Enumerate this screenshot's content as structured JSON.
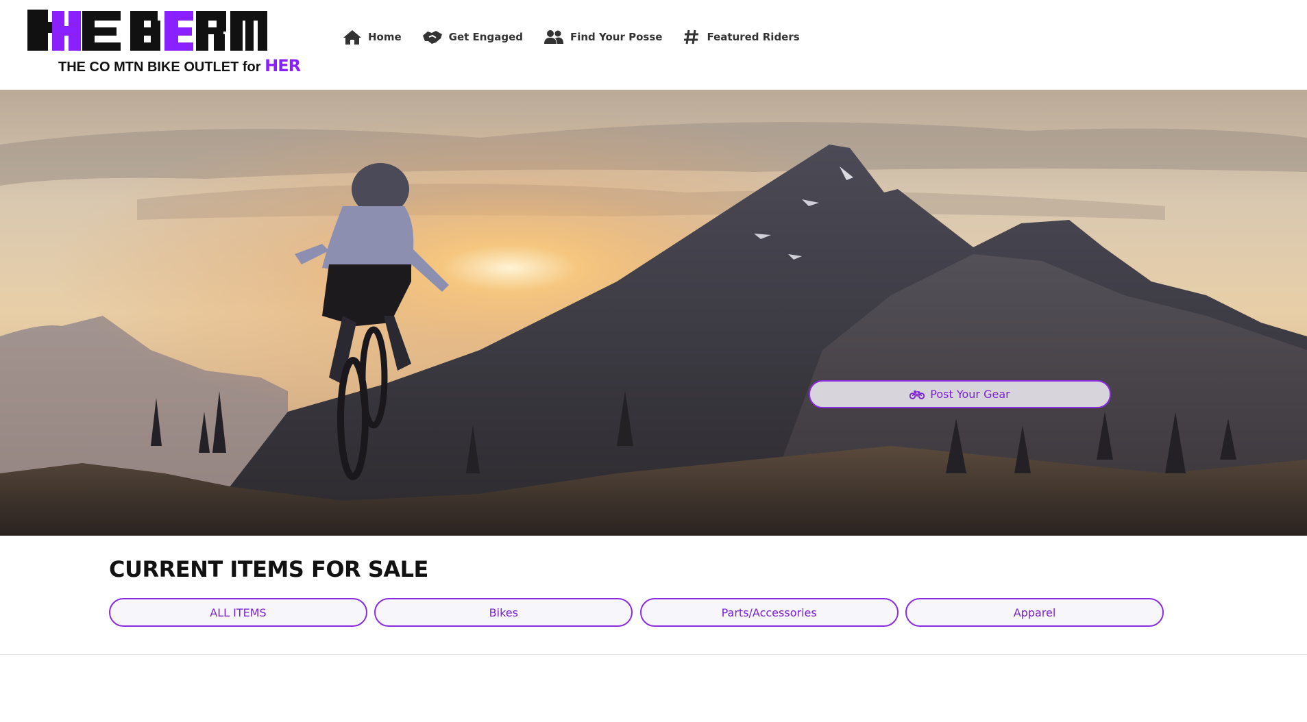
{
  "brand": {
    "logo_word": "tHE BERM",
    "tagline": "THE CO MTN BIKE OUTLET for",
    "tagline_accent": "HER",
    "colors": {
      "accent": "#8a1fff",
      "dark": "#111111"
    }
  },
  "nav": {
    "items": [
      {
        "label": "Home",
        "icon": "home-icon"
      },
      {
        "label": "Get Engaged",
        "icon": "handshake-icon"
      },
      {
        "label": "Find Your Posse",
        "icon": "users-icon"
      },
      {
        "label": "Featured Riders",
        "icon": "hashtag-icon"
      }
    ]
  },
  "hero": {
    "image": "mountain-biker-jumping-at-sunset",
    "post_button": {
      "label": "Post Your Gear",
      "icon": "bicycle-icon"
    }
  },
  "items": {
    "title": "CURRENT ITEMS FOR SALE",
    "filters": [
      "ALL ITEMS",
      "Bikes",
      "Parts/Accessories",
      "Apparel"
    ]
  }
}
